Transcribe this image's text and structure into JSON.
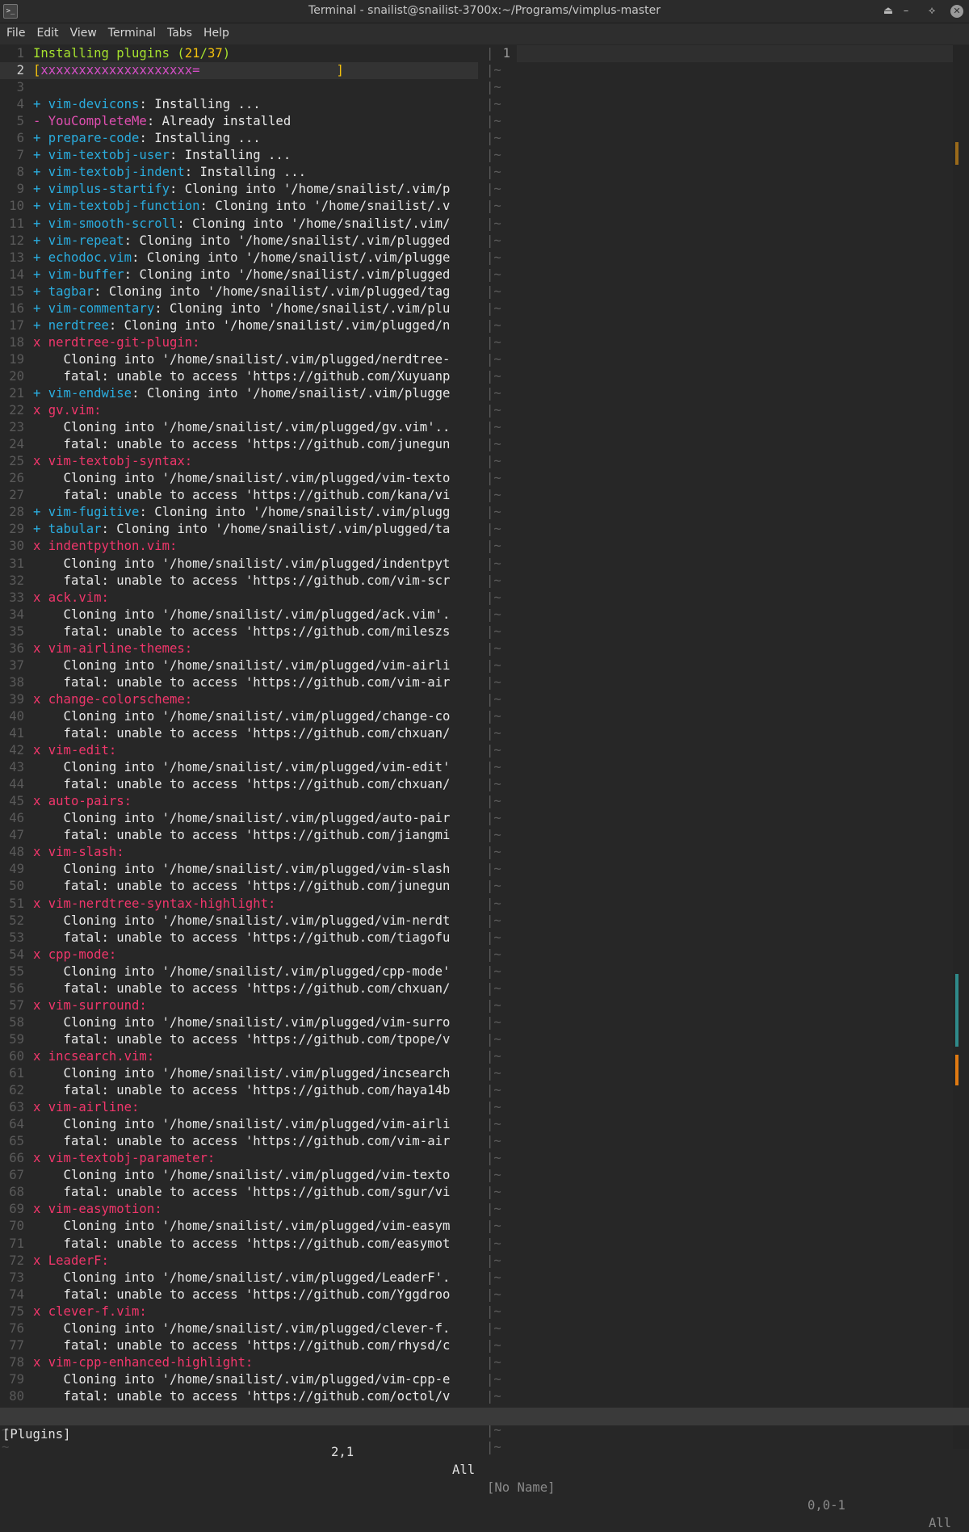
{
  "window": {
    "title": "Terminal - snailist@snailist-3700x:~/Programs/vimplus-master",
    "app_icon": ">_",
    "buttons": {
      "shade": "⏏",
      "minimize": "–",
      "maximize": "⟡",
      "close": "✕"
    }
  },
  "menu": [
    "File",
    "Edit",
    "View",
    "Terminal",
    "Tabs",
    "Help"
  ],
  "left_pane": {
    "lines": [
      {
        "n": "1",
        "segs": [
          [
            "Installing plugins (",
            "green"
          ],
          [
            "21",
            "c-bracket"
          ],
          [
            "/",
            "green"
          ],
          [
            "37",
            "c-bracket"
          ],
          [
            ")",
            "green"
          ]
        ]
      },
      {
        "n": "2",
        "cur": true,
        "segs": [
          [
            "[",
            "bracket"
          ],
          [
            "xxxxxxxxxxxxxxxxxxxx=",
            "bar"
          ],
          [
            "                  ",
            "text"
          ],
          [
            "]",
            "bracket"
          ]
        ]
      },
      {
        "n": "3",
        "segs": []
      },
      {
        "n": "4",
        "segs": [
          [
            "+ vim-devicons",
            "cyan"
          ],
          [
            ": Installing ...",
            "text"
          ]
        ]
      },
      {
        "n": "5",
        "segs": [
          [
            "- YouCompleteMe",
            "magenta"
          ],
          [
            ": Already installed",
            "text"
          ]
        ]
      },
      {
        "n": "6",
        "segs": [
          [
            "+ prepare-code",
            "cyan"
          ],
          [
            ": Installing ...",
            "text"
          ]
        ]
      },
      {
        "n": "7",
        "segs": [
          [
            "+ vim-textobj-user",
            "cyan"
          ],
          [
            ": Installing ...",
            "text"
          ]
        ]
      },
      {
        "n": "8",
        "segs": [
          [
            "+ vim-textobj-indent",
            "cyan"
          ],
          [
            ": Installing ...",
            "text"
          ]
        ]
      },
      {
        "n": "9",
        "segs": [
          [
            "+ vimplus-startify",
            "cyan"
          ],
          [
            ": Cloning into '/home/snailist/.vim/p",
            "text"
          ]
        ]
      },
      {
        "n": "10",
        "segs": [
          [
            "+ vim-textobj-function",
            "cyan"
          ],
          [
            ": Cloning into '/home/snailist/.v",
            "text"
          ]
        ]
      },
      {
        "n": "11",
        "segs": [
          [
            "+ vim-smooth-scroll",
            "cyan"
          ],
          [
            ": Cloning into '/home/snailist/.vim/",
            "text"
          ]
        ]
      },
      {
        "n": "12",
        "segs": [
          [
            "+ vim-repeat",
            "cyan"
          ],
          [
            ": Cloning into '/home/snailist/.vim/plugged",
            "text"
          ]
        ]
      },
      {
        "n": "13",
        "segs": [
          [
            "+ echodoc.vim",
            "cyan"
          ],
          [
            ": Cloning into '/home/snailist/.vim/plugge",
            "text"
          ]
        ]
      },
      {
        "n": "14",
        "segs": [
          [
            "+ vim-buffer",
            "cyan"
          ],
          [
            ": Cloning into '/home/snailist/.vim/plugged",
            "text"
          ]
        ]
      },
      {
        "n": "15",
        "segs": [
          [
            "+ tagbar",
            "cyan"
          ],
          [
            ": Cloning into '/home/snailist/.vim/plugged/tag",
            "text"
          ]
        ]
      },
      {
        "n": "16",
        "segs": [
          [
            "+ vim-commentary",
            "cyan"
          ],
          [
            ": Cloning into '/home/snailist/.vim/plu",
            "text"
          ]
        ]
      },
      {
        "n": "17",
        "segs": [
          [
            "+ nerdtree",
            "cyan"
          ],
          [
            ": Cloning into '/home/snailist/.vim/plugged/n",
            "text"
          ]
        ]
      },
      {
        "n": "18",
        "segs": [
          [
            "x nerdtree-git-plugin:",
            "red"
          ]
        ]
      },
      {
        "n": "19",
        "segs": [
          [
            "    Cloning into '/home/snailist/.vim/plugged/nerdtree-",
            "text"
          ]
        ]
      },
      {
        "n": "20",
        "segs": [
          [
            "    fatal: unable to access 'https://github.com/Xuyuanp",
            "text"
          ]
        ]
      },
      {
        "n": "21",
        "segs": [
          [
            "+ vim-endwise",
            "cyan"
          ],
          [
            ": Cloning into '/home/snailist/.vim/plugge",
            "text"
          ]
        ]
      },
      {
        "n": "22",
        "segs": [
          [
            "x gv.vim:",
            "red"
          ]
        ]
      },
      {
        "n": "23",
        "segs": [
          [
            "    Cloning into '/home/snailist/.vim/plugged/gv.vim'..",
            "text"
          ]
        ]
      },
      {
        "n": "24",
        "segs": [
          [
            "    fatal: unable to access 'https://github.com/junegun",
            "text"
          ]
        ]
      },
      {
        "n": "25",
        "segs": [
          [
            "x vim-textobj-syntax:",
            "red"
          ]
        ]
      },
      {
        "n": "26",
        "segs": [
          [
            "    Cloning into '/home/snailist/.vim/plugged/vim-texto",
            "text"
          ]
        ]
      },
      {
        "n": "27",
        "segs": [
          [
            "    fatal: unable to access 'https://github.com/kana/vi",
            "text"
          ]
        ]
      },
      {
        "n": "28",
        "segs": [
          [
            "+ vim-fugitive",
            "cyan"
          ],
          [
            ": Cloning into '/home/snailist/.vim/plugg",
            "text"
          ]
        ]
      },
      {
        "n": "29",
        "segs": [
          [
            "+ tabular",
            "cyan"
          ],
          [
            ": Cloning into '/home/snailist/.vim/plugged/ta",
            "text"
          ]
        ]
      },
      {
        "n": "30",
        "segs": [
          [
            "x indentpython.vim:",
            "red"
          ]
        ]
      },
      {
        "n": "31",
        "segs": [
          [
            "    Cloning into '/home/snailist/.vim/plugged/indentpyt",
            "text"
          ]
        ]
      },
      {
        "n": "32",
        "segs": [
          [
            "    fatal: unable to access 'https://github.com/vim-scr",
            "text"
          ]
        ]
      },
      {
        "n": "33",
        "segs": [
          [
            "x ack.vim:",
            "red"
          ]
        ]
      },
      {
        "n": "34",
        "segs": [
          [
            "    Cloning into '/home/snailist/.vim/plugged/ack.vim'.",
            "text"
          ]
        ]
      },
      {
        "n": "35",
        "segs": [
          [
            "    fatal: unable to access 'https://github.com/mileszs",
            "text"
          ]
        ]
      },
      {
        "n": "36",
        "segs": [
          [
            "x vim-airline-themes:",
            "red"
          ]
        ]
      },
      {
        "n": "37",
        "segs": [
          [
            "    Cloning into '/home/snailist/.vim/plugged/vim-airli",
            "text"
          ]
        ]
      },
      {
        "n": "38",
        "segs": [
          [
            "    fatal: unable to access 'https://github.com/vim-air",
            "text"
          ]
        ]
      },
      {
        "n": "39",
        "segs": [
          [
            "x change-colorscheme:",
            "red"
          ]
        ]
      },
      {
        "n": "40",
        "segs": [
          [
            "    Cloning into '/home/snailist/.vim/plugged/change-co",
            "text"
          ]
        ]
      },
      {
        "n": "41",
        "segs": [
          [
            "    fatal: unable to access 'https://github.com/chxuan/",
            "text"
          ]
        ]
      },
      {
        "n": "42",
        "segs": [
          [
            "x vim-edit:",
            "red"
          ]
        ]
      },
      {
        "n": "43",
        "segs": [
          [
            "    Cloning into '/home/snailist/.vim/plugged/vim-edit'",
            "text"
          ]
        ]
      },
      {
        "n": "44",
        "segs": [
          [
            "    fatal: unable to access 'https://github.com/chxuan/",
            "text"
          ]
        ]
      },
      {
        "n": "45",
        "segs": [
          [
            "x auto-pairs:",
            "red"
          ]
        ]
      },
      {
        "n": "46",
        "segs": [
          [
            "    Cloning into '/home/snailist/.vim/plugged/auto-pair",
            "text"
          ]
        ]
      },
      {
        "n": "47",
        "segs": [
          [
            "    fatal: unable to access 'https://github.com/jiangmi",
            "text"
          ]
        ]
      },
      {
        "n": "48",
        "segs": [
          [
            "x vim-slash:",
            "red"
          ]
        ]
      },
      {
        "n": "49",
        "segs": [
          [
            "    Cloning into '/home/snailist/.vim/plugged/vim-slash",
            "text"
          ]
        ]
      },
      {
        "n": "50",
        "segs": [
          [
            "    fatal: unable to access 'https://github.com/junegun",
            "text"
          ]
        ]
      },
      {
        "n": "51",
        "segs": [
          [
            "x vim-nerdtree-syntax-highlight:",
            "red"
          ]
        ]
      },
      {
        "n": "52",
        "segs": [
          [
            "    Cloning into '/home/snailist/.vim/plugged/vim-nerdt",
            "text"
          ]
        ]
      },
      {
        "n": "53",
        "segs": [
          [
            "    fatal: unable to access 'https://github.com/tiagofu",
            "text"
          ]
        ]
      },
      {
        "n": "54",
        "segs": [
          [
            "x cpp-mode:",
            "red"
          ]
        ]
      },
      {
        "n": "55",
        "segs": [
          [
            "    Cloning into '/home/snailist/.vim/plugged/cpp-mode'",
            "text"
          ]
        ]
      },
      {
        "n": "56",
        "segs": [
          [
            "    fatal: unable to access 'https://github.com/chxuan/",
            "text"
          ]
        ]
      },
      {
        "n": "57",
        "segs": [
          [
            "x vim-surround:",
            "red"
          ]
        ]
      },
      {
        "n": "58",
        "segs": [
          [
            "    Cloning into '/home/snailist/.vim/plugged/vim-surro",
            "text"
          ]
        ]
      },
      {
        "n": "59",
        "segs": [
          [
            "    fatal: unable to access 'https://github.com/tpope/v",
            "text"
          ]
        ]
      },
      {
        "n": "60",
        "segs": [
          [
            "x incsearch.vim:",
            "red"
          ]
        ]
      },
      {
        "n": "61",
        "segs": [
          [
            "    Cloning into '/home/snailist/.vim/plugged/incsearch",
            "text"
          ]
        ]
      },
      {
        "n": "62",
        "segs": [
          [
            "    fatal: unable to access 'https://github.com/haya14b",
            "text"
          ]
        ]
      },
      {
        "n": "63",
        "segs": [
          [
            "x vim-airline:",
            "red"
          ]
        ]
      },
      {
        "n": "64",
        "segs": [
          [
            "    Cloning into '/home/snailist/.vim/plugged/vim-airli",
            "text"
          ]
        ]
      },
      {
        "n": "65",
        "segs": [
          [
            "    fatal: unable to access 'https://github.com/vim-air",
            "text"
          ]
        ]
      },
      {
        "n": "66",
        "segs": [
          [
            "x vim-textobj-parameter:",
            "red"
          ]
        ]
      },
      {
        "n": "67",
        "segs": [
          [
            "    Cloning into '/home/snailist/.vim/plugged/vim-texto",
            "text"
          ]
        ]
      },
      {
        "n": "68",
        "segs": [
          [
            "    fatal: unable to access 'https://github.com/sgur/vi",
            "text"
          ]
        ]
      },
      {
        "n": "69",
        "segs": [
          [
            "x vim-easymotion:",
            "red"
          ]
        ]
      },
      {
        "n": "70",
        "segs": [
          [
            "    Cloning into '/home/snailist/.vim/plugged/vim-easym",
            "text"
          ]
        ]
      },
      {
        "n": "71",
        "segs": [
          [
            "    fatal: unable to access 'https://github.com/easymot",
            "text"
          ]
        ]
      },
      {
        "n": "72",
        "segs": [
          [
            "x LeaderF:",
            "red"
          ]
        ]
      },
      {
        "n": "73",
        "segs": [
          [
            "    Cloning into '/home/snailist/.vim/plugged/LeaderF'.",
            "text"
          ]
        ]
      },
      {
        "n": "74",
        "segs": [
          [
            "    fatal: unable to access 'https://github.com/Yggdroo",
            "text"
          ]
        ]
      },
      {
        "n": "75",
        "segs": [
          [
            "x clever-f.vim:",
            "red"
          ]
        ]
      },
      {
        "n": "76",
        "segs": [
          [
            "    Cloning into '/home/snailist/.vim/plugged/clever-f.",
            "text"
          ]
        ]
      },
      {
        "n": "77",
        "segs": [
          [
            "    fatal: unable to access 'https://github.com/rhysd/c",
            "text"
          ]
        ]
      },
      {
        "n": "78",
        "segs": [
          [
            "x vim-cpp-enhanced-highlight:",
            "red"
          ]
        ]
      },
      {
        "n": "79",
        "segs": [
          [
            "    Cloning into '/home/snailist/.vim/plugged/vim-cpp-e",
            "text"
          ]
        ]
      },
      {
        "n": "80",
        "segs": [
          [
            "    fatal: unable to access 'https://github.com/octol/v",
            "text"
          ]
        ]
      }
    ],
    "filler_rows": 3,
    "filler_char": "~"
  },
  "separator": {
    "char": "|",
    "right_filler": "~"
  },
  "right_pane": {
    "line_number": "1"
  },
  "status": {
    "left_name": "[Plugins]",
    "left_pos": "2,1",
    "left_pct": "All",
    "right_name": "[No Name]",
    "right_pos": "0,0-1",
    "right_pct": "All"
  },
  "colors": {
    "green": "#a6e22e",
    "cyan": "#2aaddf",
    "magenta": "#e04fb1",
    "red": "#f0366b",
    "bracket": "#f4c20d",
    "bar": "#d44ec6",
    "text": "#e8e8e8"
  },
  "minimap_colors": [
    "#9a6a1a",
    "#2f8a8a",
    "#2f8a8a",
    "#e07a12"
  ]
}
